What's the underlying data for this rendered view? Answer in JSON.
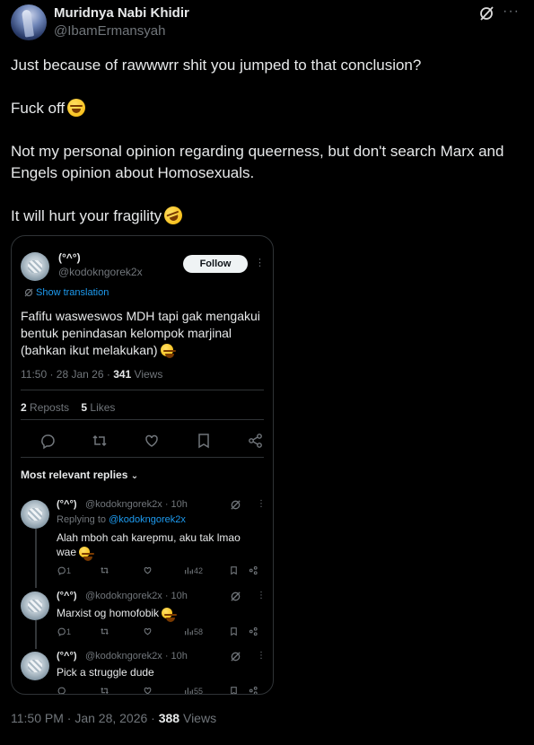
{
  "post": {
    "author_name": "Muridnya Nabi Khidir",
    "author_handle": "@IbamErmansyah",
    "paragraphs": [
      "Just because of rawwwrr shit you jumped to that conclusion?",
      "Fuck off",
      "Not my personal opinion regarding queerness, but  don't search Marx and Engels opinion about Homosexuals.",
      "It will hurt your fragility"
    ],
    "timestamp": "11:50 PM · Jan 28, 2026 · ",
    "views_count": "388",
    "views_label": " Views",
    "icons": {
      "grok": "grok-icon",
      "more": "more-icon"
    }
  },
  "quoted": {
    "author_name": "(°^°)",
    "author_handle": "@kodokngorek2x",
    "follow_label": "Follow",
    "show_translation": "Show translation",
    "text": "Fafifu wasweswos MDH tapi gak mengakui bentuk penindasan kelompok marjinal (bahkan ikut melakukan)",
    "meta_prefix": "11:50 · 28 Jan 26 · ",
    "views_count": "341",
    "views_label": " Views",
    "reposts_count": "2",
    "reposts_label": " Reposts",
    "likes_count": "5",
    "likes_label": " Likes",
    "replies_heading": "Most relevant replies"
  },
  "replies": [
    {
      "name": "(°^°)",
      "handle_time": "@kodokngorek2x · 10h",
      "replying_prefix": "Replying to ",
      "replying_to": "@kodokngorek2x",
      "text": "Alah mboh cah karepmu, aku tak lmao wae",
      "reply_count": "1",
      "views": "42"
    },
    {
      "name": "(°^°)",
      "handle_time": "@kodokngorek2x · 10h",
      "text": "Marxist og homofobik",
      "reply_count": "1",
      "views": "58"
    },
    {
      "name": "(°^°)",
      "handle_time": "@kodokngorek2x · 10h",
      "text": "Pick a struggle dude",
      "views": "55"
    }
  ],
  "colors": {
    "background": "#000000",
    "text_primary": "#e7e9ea",
    "text_secondary": "#71767b",
    "accent_blue": "#1d9bf0",
    "border": "#2f3336"
  }
}
